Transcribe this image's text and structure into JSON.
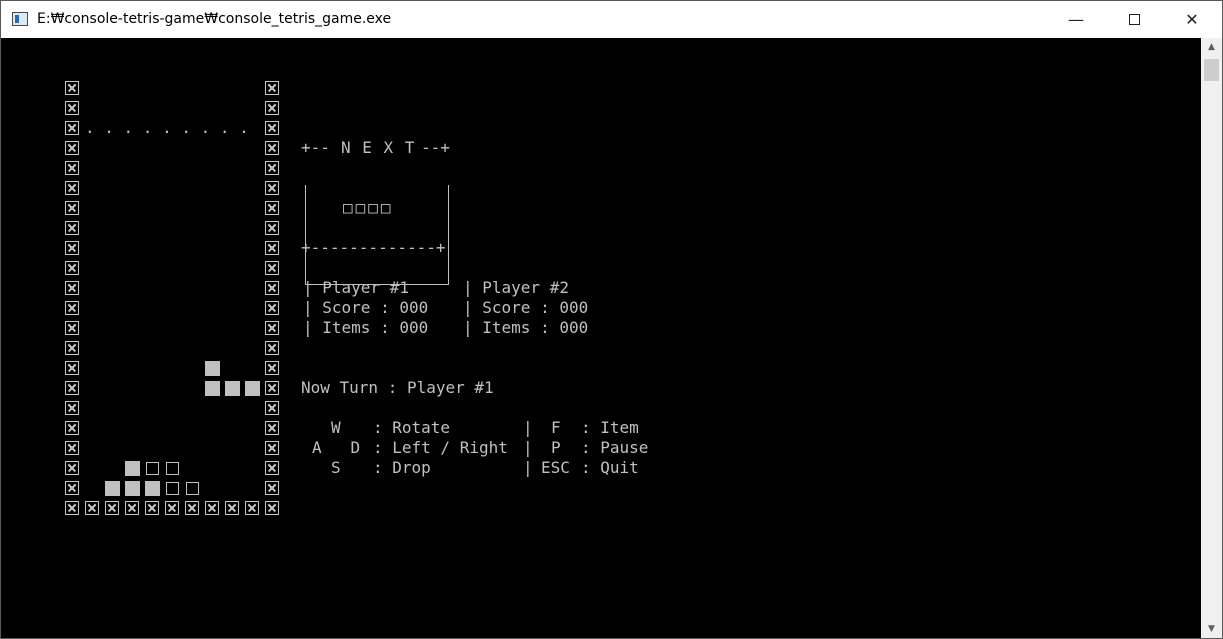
{
  "window": {
    "title": "E:₩console-tetris-game₩console_tetris_game.exe",
    "minimize_glyph": "—",
    "close_glyph": "✕",
    "icon": "console-app-icon"
  },
  "board": {
    "dotted_line": ". . . . . . . . .",
    "active_piece": "J-tetromino",
    "stack": "locked-blocks"
  },
  "next": {
    "label": "N E X T",
    "piece": "□□□□"
  },
  "players": [
    {
      "name": "Player #1",
      "score_label": "Score",
      "score": "000",
      "items_label": "Items",
      "items": "000"
    },
    {
      "name": "Player #2",
      "score_label": "Score",
      "score": "000",
      "items_label": "Items",
      "items": "000"
    }
  ],
  "turn": {
    "label": "Now Turn",
    "value": "Player #1"
  },
  "controls": {
    "rotate_key": "W",
    "rotate_label": "Rotate",
    "move_keys": "A   D",
    "move_label": "Left / Right",
    "drop_key": "S",
    "drop_label": "Drop",
    "item_key": "F",
    "item_label": "Item",
    "pause_key": "P",
    "pause_label": "Pause",
    "quit_key": "ESC",
    "quit_label": "Quit"
  },
  "colors": {
    "console_bg": "#000000",
    "console_fg": "#c0c0c0"
  }
}
